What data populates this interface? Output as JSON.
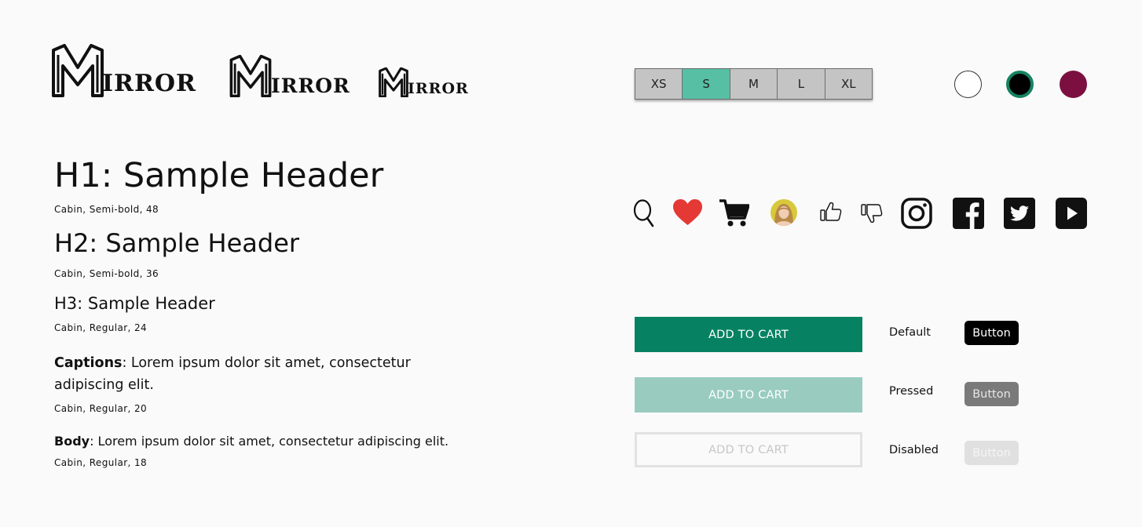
{
  "logos": [
    {
      "variant": "large",
      "text": "IRROR"
    },
    {
      "variant": "medium",
      "text": "IRROR"
    },
    {
      "variant": "small",
      "text": "IRROR"
    }
  ],
  "sizes": {
    "options": [
      "XS",
      "S",
      "M",
      "L",
      "XL"
    ],
    "selected": "S",
    "selected_color": "#57bfa4"
  },
  "swatches": [
    {
      "name": "white",
      "color": "#ffffff"
    },
    {
      "name": "black",
      "color": "#000000",
      "ring": "#168262",
      "selected": true
    },
    {
      "name": "wine",
      "color": "#7b1040"
    }
  ],
  "typography": {
    "h1": {
      "text": "H1: Sample Header",
      "spec": "Cabin, Semi-bold, 48"
    },
    "h2": {
      "text": "H2: Sample Header",
      "spec": "Cabin, Semi-bold, 36"
    },
    "h3": {
      "text": "H3: Sample Header",
      "spec": "Cabin, Regular, 24"
    },
    "caption": {
      "label": "Captions",
      "text": ": Lorem ipsum dolor sit amet, consectetur adipiscing elit.",
      "spec": "Cabin, Regular, 20"
    },
    "body": {
      "label": "Body",
      "text": ": Lorem ipsum dolor sit amet, consectetur adipiscing elit.",
      "spec": "Cabin, Regular, 18"
    }
  },
  "icons": [
    "search-icon",
    "heart-icon",
    "cart-icon",
    "avatar",
    "thumbs-up-icon",
    "thumbs-down-icon",
    "instagram-icon",
    "facebook-icon",
    "twitter-icon",
    "youtube-icon"
  ],
  "colors": {
    "primary": "#068262",
    "primary_pressed": "#99ccbf",
    "heart": "#e53935",
    "wine": "#7b1040"
  },
  "buttons": {
    "add_to_cart": "ADD TO CART",
    "button": "Button",
    "states": [
      "Default",
      "Pressed",
      "Disabled"
    ]
  }
}
